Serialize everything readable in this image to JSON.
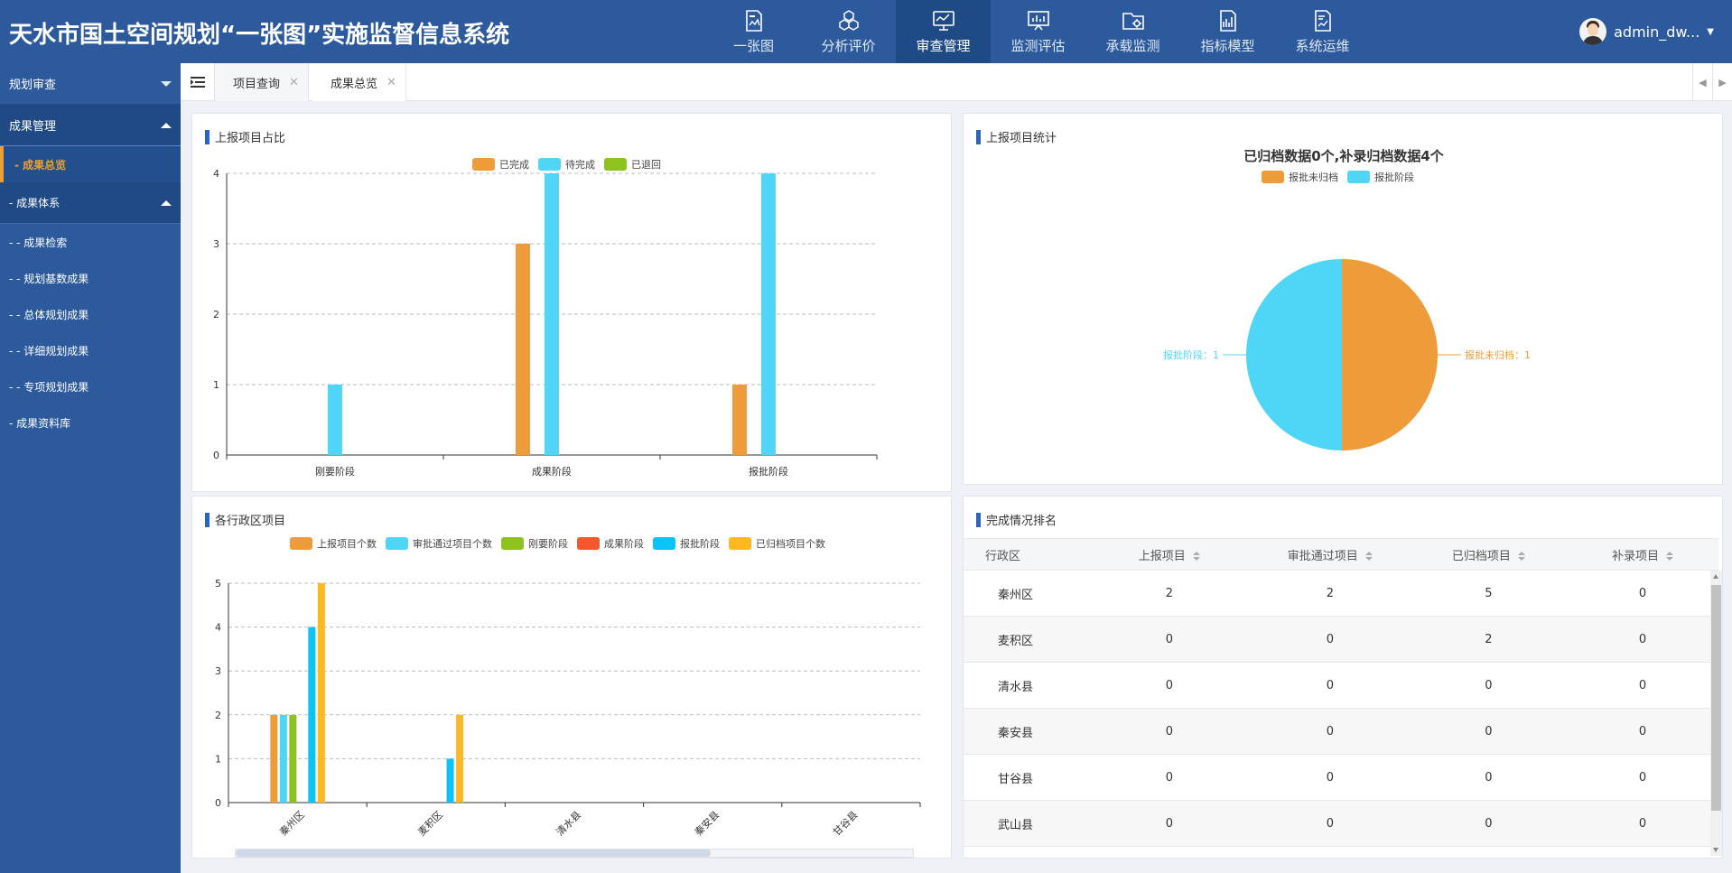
{
  "header": {
    "title": "天水市国土空间规划“一张图”实施监督信息系统",
    "nav": [
      {
        "label": "一张图",
        "icon": "map-doc-icon"
      },
      {
        "label": "分析评价",
        "icon": "cubes-icon"
      },
      {
        "label": "审查管理",
        "icon": "monitor-chart-icon"
      },
      {
        "label": "监测评估",
        "icon": "monitor-board-icon"
      },
      {
        "label": "承载监测",
        "icon": "folder-gear-icon"
      },
      {
        "label": "指标模型",
        "icon": "chart-doc-icon"
      },
      {
        "label": "系统运维",
        "icon": "report-doc-icon"
      }
    ],
    "active_nav": "审查管理",
    "user": "admin_dw..."
  },
  "sidebar": {
    "group1": "规划审查",
    "group2": "成果管理",
    "active_item": "- 成果总览",
    "subgroup": "- 成果体系",
    "leaves": [
      "- - 成果检索",
      "- - 规划基数成果",
      "- - 总体规划成果",
      "- - 详细规划成果",
      "- - 专项规划成果",
      "- 成果资料库"
    ]
  },
  "tabs": [
    {
      "label": "项目查询"
    },
    {
      "label": "成果总览"
    }
  ],
  "panels": {
    "p1_title": "上报项目占比",
    "p2_title": "上报项目统计",
    "p3_title": "各行政区项目",
    "p4_title": "完成情况排名"
  },
  "chart_data": [
    {
      "type": "bar",
      "title": "",
      "categories": [
        "刚要阶段",
        "成果阶段",
        "报批阶段"
      ],
      "series": [
        {
          "name": "已完成",
          "values": [
            0,
            3,
            1
          ],
          "color": "#ee9c3a"
        },
        {
          "name": "待完成",
          "values": [
            1,
            4,
            4
          ],
          "color": "#4fd6f7"
        },
        {
          "name": "已退回",
          "values": [
            0,
            0,
            0
          ],
          "color": "#8dc21f"
        }
      ],
      "ylim": [
        0,
        4
      ],
      "yticks": [
        0,
        1,
        2,
        3,
        4
      ],
      "grid": true,
      "legend": "top-center"
    },
    {
      "type": "pie",
      "title": "已归档数据0个,补录归档数据4个",
      "slices": [
        {
          "name": "报批未归档",
          "value": 1,
          "color": "#ee9c3a",
          "label": "报批未归档：1"
        },
        {
          "name": "报批阶段",
          "value": 1,
          "color": "#4fd6f7",
          "label": "报批阶段：1"
        }
      ],
      "legend": "top-center"
    },
    {
      "type": "bar",
      "title": "",
      "categories": [
        "秦州区",
        "麦积区",
        "清水县",
        "秦安县",
        "甘谷县"
      ],
      "series": [
        {
          "name": "上报项目个数",
          "values": [
            2,
            0,
            0,
            0,
            0
          ],
          "color": "#ee9c3a"
        },
        {
          "name": "审批通过项目个数",
          "values": [
            2,
            0,
            0,
            0,
            0
          ],
          "color": "#4fd6f7"
        },
        {
          "name": "刚要阶段",
          "values": [
            2,
            0,
            0,
            0,
            0
          ],
          "color": "#8dc21f"
        },
        {
          "name": "成果阶段",
          "values": [
            0,
            0,
            0,
            0,
            0
          ],
          "color": "#f2572d"
        },
        {
          "name": "报批阶段",
          "values": [
            4,
            1,
            0,
            0,
            0
          ],
          "color": "#09c4f4"
        },
        {
          "name": "已归档项目个数",
          "values": [
            5,
            2,
            0,
            0,
            0
          ],
          "color": "#fdb824"
        }
      ],
      "ylim": [
        0,
        5
      ],
      "yticks": [
        0,
        1,
        2,
        3,
        4,
        5
      ],
      "grid": true,
      "legend": "top-center"
    }
  ],
  "table": {
    "headers": [
      "行政区",
      "上报项目",
      "审批通过项目",
      "已归档项目",
      "补录项目"
    ],
    "rows": [
      [
        "秦州区",
        "2",
        "2",
        "5",
        "0"
      ],
      [
        "麦积区",
        "0",
        "0",
        "2",
        "0"
      ],
      [
        "清水县",
        "0",
        "0",
        "0",
        "0"
      ],
      [
        "秦安县",
        "0",
        "0",
        "0",
        "0"
      ],
      [
        "甘谷县",
        "0",
        "0",
        "0",
        "0"
      ],
      [
        "武山县",
        "0",
        "0",
        "0",
        "0"
      ]
    ]
  }
}
